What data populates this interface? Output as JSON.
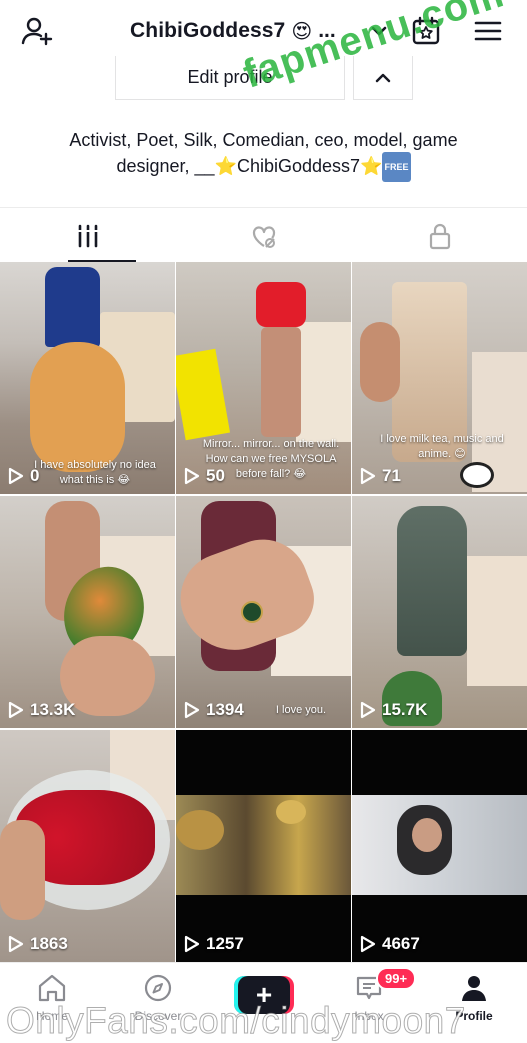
{
  "header": {
    "username": "ChibiGoddess7",
    "username_emoji": "😍",
    "ellipsis": "...",
    "icons": [
      "add-user-icon",
      "chevron-down-icon",
      "calendar-star-icon",
      "menu-icon"
    ]
  },
  "profile": {
    "edit_label": "Edit profile",
    "bio_line1": "Activist, Poet, Silk, Comedian, ceo, model, game",
    "bio_line2_pre": "designer, __",
    "bio_name": "ChibiGoddess7",
    "bio_badge": "FREE"
  },
  "tabs": [
    "videos-grid-icon",
    "liked-hidden-icon",
    "private-lock-icon"
  ],
  "videos": [
    {
      "views": "0",
      "caption": "I have absolutely no idea what this is 😂"
    },
    {
      "views": "50",
      "caption": "Mirror... mirror... on the wall. How can we free MYSOLA before fall? 😂"
    },
    {
      "views": "71",
      "caption": "I love milk tea, music and anime. 😊"
    },
    {
      "views": "13.3K",
      "caption": ""
    },
    {
      "views": "1394",
      "caption": "I love you."
    },
    {
      "views": "15.7K",
      "caption": ""
    },
    {
      "views": "1863",
      "caption": ""
    },
    {
      "views": "1257",
      "caption": ""
    },
    {
      "views": "4667",
      "caption": ""
    }
  ],
  "nav": {
    "home": "Home",
    "discover": "Discover",
    "inbox": "Inbox",
    "inbox_badge": "99+",
    "profile": "Profile",
    "create": "+"
  },
  "watermarks": {
    "top": "fapmenu.com",
    "bottom": "OnlyFans.com/cindymoon7"
  },
  "colors": {
    "accent_red": "#fe2c55",
    "accent_cyan": "#25f4ee",
    "text": "#161823",
    "free_badge": "#5a87c4"
  }
}
